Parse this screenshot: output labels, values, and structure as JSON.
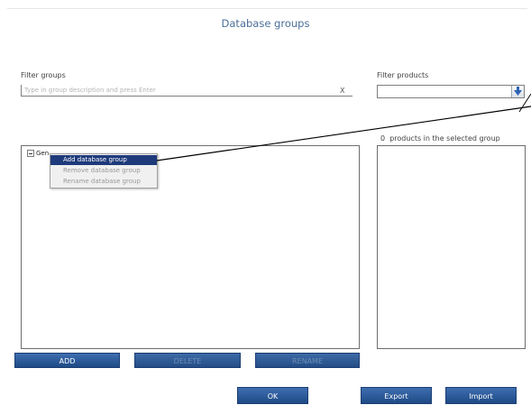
{
  "dialog": {
    "title": "Database groups"
  },
  "filter_groups": {
    "label": "Filter groups",
    "placeholder": "Type in group description and press Enter",
    "value": "",
    "clear_label": "X"
  },
  "filter_products": {
    "label": "Filter products",
    "value": "",
    "dropdown_icon": "down-arrow-icon"
  },
  "products_panel": {
    "count": "0",
    "count_label": "products in the selected group"
  },
  "tree": {
    "root_label": "Gen",
    "collapse_icon": "minus-box-icon"
  },
  "context_menu": {
    "items": [
      {
        "label": "Add database group",
        "state": "highlighted"
      },
      {
        "label": "Remove database group",
        "state": "disabled"
      },
      {
        "label": "Rename database group",
        "state": "disabled"
      }
    ]
  },
  "buttons": {
    "add": "ADD",
    "delete": "DELETE",
    "rename": "RENAME",
    "ok": "OK",
    "export": "Export",
    "import": "Import"
  },
  "colors": {
    "button_blue": "#2b5a98",
    "menu_highlight": "#1e3a7b",
    "title_blue": "#4a6f99"
  }
}
